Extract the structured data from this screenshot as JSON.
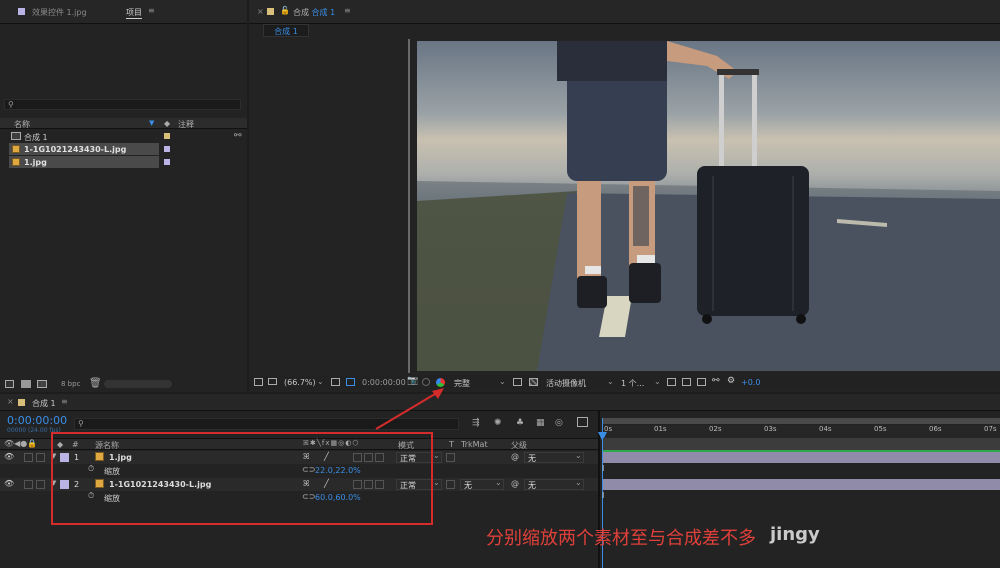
{
  "project_panel": {
    "tab_effects": "效果控件 1.jpg",
    "tab_project": "项目",
    "menu_glyph": "≡",
    "col_name": "名称",
    "col_comment": "注释",
    "items": [
      {
        "name": "合成 1",
        "type": "comp"
      },
      {
        "name": "1-1G1021243430-L.jpg",
        "type": "footage"
      },
      {
        "name": "1.jpg",
        "type": "footage"
      }
    ],
    "bpc": "8 bpc"
  },
  "comp_viewer": {
    "tab_title": "合成",
    "tab_title_blue": "合成 1",
    "menu_glyph": "≡",
    "sub_tab": "合成 1",
    "zoom": "(66.7%)",
    "timecode": "0:00:00:00",
    "resolution": "完整",
    "camera": "活动摄像机",
    "views": "1 个...",
    "exposure": "+0.0"
  },
  "timeline": {
    "tab": "合成 1",
    "menu_glyph": "≡",
    "timecode": "0:00:00:00",
    "fps": "00000 (24.00 fps)",
    "headers": {
      "num": "#",
      "source": "源名称",
      "mode": "模式",
      "t": "T",
      "trkmat": "TrkMat",
      "parent": "父级"
    },
    "layers": [
      {
        "num": "1",
        "name": "1.jpg",
        "mode": "正常",
        "trkmat": "",
        "parent": "无",
        "prop": "缩放",
        "value": "22.0,22.0%",
        "color": "#b9b3e6"
      },
      {
        "num": "2",
        "name": "1-1G1021243430-L.jpg",
        "mode": "正常",
        "trkmat": "无",
        "parent": "无",
        "prop": "缩放",
        "value": "60.0,60.0%",
        "color": "#b9b3e6"
      }
    ],
    "ruler": [
      "0s",
      "01s",
      "02s",
      "03s",
      "04s",
      "05s",
      "06s",
      "07s"
    ]
  },
  "annotation": {
    "text": "分别缩放两个素材至与合成差不多",
    "watermark": "jingy"
  },
  "colors": {
    "accent": "#3a8ee6",
    "highlight": "#d62b2b",
    "label": "#b9b3e6"
  }
}
